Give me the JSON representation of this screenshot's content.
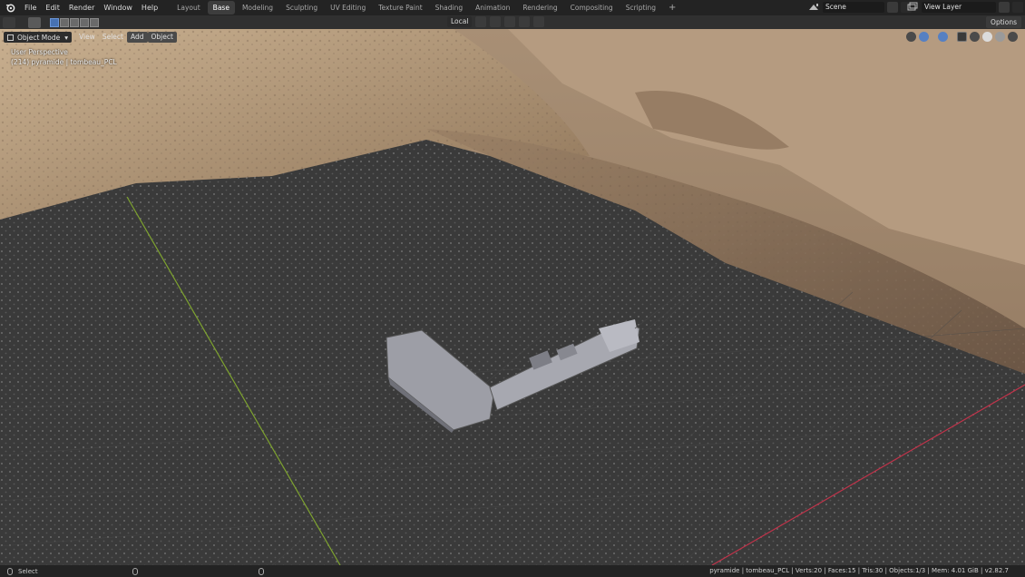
{
  "menu": [
    "File",
    "Edit",
    "Render",
    "Window",
    "Help"
  ],
  "workspace_tabs": [
    "Layout",
    "Base",
    "Modeling",
    "Sculpting",
    "UV Editing",
    "Texture Paint",
    "Shading",
    "Animation",
    "Rendering",
    "Compositing",
    "Scripting"
  ],
  "active_tab": "Base",
  "add_tab_label": "+",
  "scene_name": "Scene",
  "view_layer_name": "View Layer",
  "toolbar": {
    "pivot_label": "Local",
    "options_label": "Options"
  },
  "viewport": {
    "mode_label": "Object Mode",
    "menus": [
      "View",
      "Select",
      "Add",
      "Object"
    ],
    "perspective_label": "User Perspective",
    "object_info": "(214) pyramide | tombeau_PCL"
  },
  "statusbar": {
    "left_label": "Select",
    "stats": "pyramide | tombeau_PCL | Verts:20 | Faces:15 | Tris:30 | Objects:1/3 | Mem: 4.01 GiB | v2.82.7"
  },
  "colors": {
    "accent": "#4772b3",
    "x_axis": "#c0334a",
    "y_axis": "#7ea32f",
    "ground": "#3b3b3b",
    "sand": "#b8a084"
  },
  "icons": {
    "blender_logo": "blender-logo-icon",
    "select_tool": "cursor-select-icon"
  }
}
